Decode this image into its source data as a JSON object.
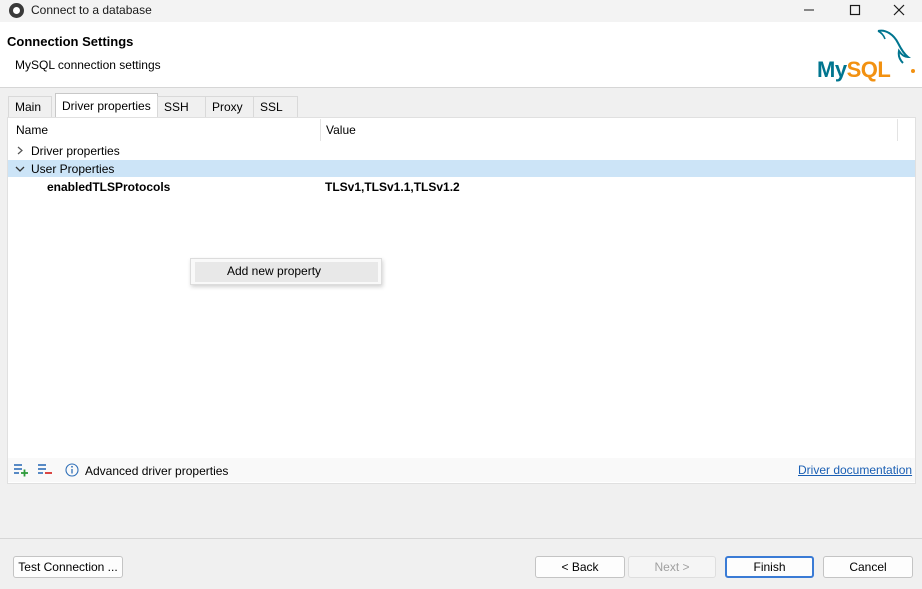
{
  "window": {
    "title": "Connect to a database",
    "minimize_icon": "minimize-icon",
    "maximize_icon": "maximize-icon",
    "close_icon": "close-icon"
  },
  "header": {
    "title": "Connection Settings",
    "subtitle": "MySQL connection settings",
    "logo_text": "MySQL",
    "logo_icon": "dolphin-icon"
  },
  "tabs": [
    {
      "label": "Main"
    },
    {
      "label": "Driver properties"
    },
    {
      "label": "SSH"
    },
    {
      "label": "Proxy"
    },
    {
      "label": "SSL"
    }
  ],
  "table": {
    "columns": [
      "Name",
      "Value"
    ],
    "groups": [
      {
        "label": "Driver properties",
        "expanded": false
      },
      {
        "label": "User Properties",
        "expanded": true
      }
    ],
    "rows": [
      {
        "name": "enabledTLSProtocols",
        "value": "TLSv1,TLSv1.1,TLSv1.2"
      }
    ]
  },
  "context_menu": {
    "items": [
      "Add new property"
    ]
  },
  "toolbar": {
    "add_icon": "add-property-icon",
    "remove_icon": "remove-property-icon",
    "info_icon": "info-icon",
    "advanced_label": "Advanced driver properties",
    "doc_link": "Driver documentation"
  },
  "footer": {
    "test_connection": "Test Connection ...",
    "back": "< Back",
    "next": "Next >",
    "finish": "Finish",
    "cancel": "Cancel"
  },
  "colors": {
    "accent": "#1a5fb4",
    "selection": "#cce4f7",
    "mysql_blue": "#00758f",
    "mysql_orange": "#f29111"
  }
}
